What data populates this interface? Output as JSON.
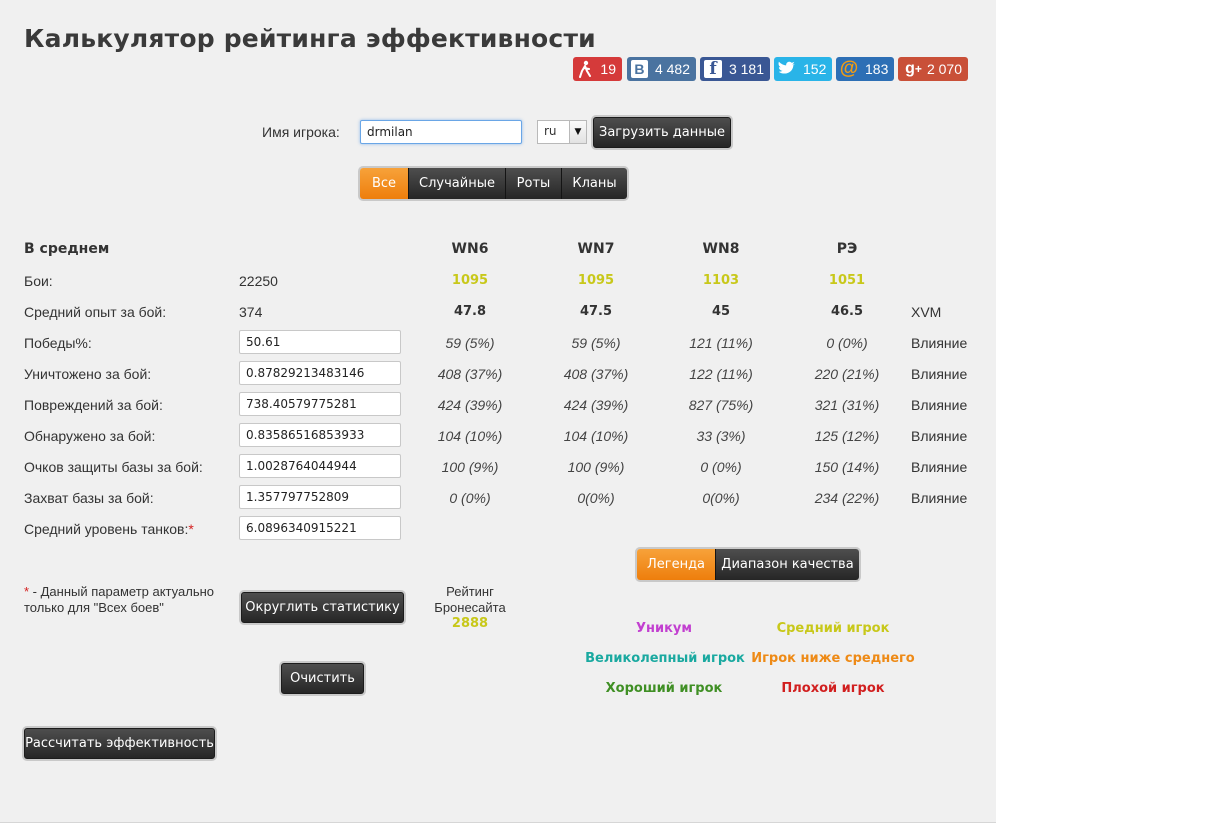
{
  "title": "Калькулятор рейтинга эффективности",
  "social": [
    {
      "name": "surfingbird",
      "count": "19",
      "color": "#d53a3a",
      "icon": "walker-icon"
    },
    {
      "name": "vk",
      "count": "4 482",
      "color": "#4a73a0",
      "icon": "vk-icon"
    },
    {
      "name": "facebook",
      "count": "3 181",
      "color": "#3a5794",
      "icon": "facebook-icon"
    },
    {
      "name": "twitter",
      "count": "152",
      "color": "#29b4e8",
      "icon": "twitter-icon"
    },
    {
      "name": "mailru",
      "count": "183",
      "color": "#2d6fb5",
      "icon": "at-icon"
    },
    {
      "name": "googleplus",
      "count": "2 070",
      "color": "#c95038",
      "icon": "gplus-icon"
    }
  ],
  "player": {
    "label": "Имя игрока:",
    "value": "drmilan",
    "server": "ru",
    "load_button": "Загрузить данные"
  },
  "filter_tabs": [
    "Все",
    "Случайные",
    "Роты",
    "Кланы"
  ],
  "table": {
    "section_label": "В среднем",
    "columns": [
      "WN6",
      "WN7",
      "WN8",
      "РЭ"
    ],
    "battles": {
      "label": "Бои:",
      "value": "22250",
      "ratings": [
        "1095",
        "1095",
        "1103",
        "1051"
      ]
    },
    "avg_xp": {
      "label": "Средний опыт за бой:",
      "value": "374",
      "ratings": [
        "47.8",
        "47.5",
        "45",
        "46.5"
      ],
      "extra": "XVM"
    },
    "rows": [
      {
        "label": "Победы%:",
        "value": "50.61",
        "cols": [
          "59 (5%)",
          "59 (5%)",
          "121 (11%)",
          "0 (0%)"
        ],
        "extra": "Влияние"
      },
      {
        "label": "Уничтожено за бой:",
        "value": "0.87829213483146",
        "cols": [
          "408 (37%)",
          "408 (37%)",
          "122 (11%)",
          "220 (21%)"
        ],
        "extra": "Влияние"
      },
      {
        "label": "Повреждений за бой:",
        "value": "738.40579775281",
        "cols": [
          "424 (39%)",
          "424 (39%)",
          "827 (75%)",
          "321 (31%)"
        ],
        "extra": "Влияние"
      },
      {
        "label": "Обнаружено за бой:",
        "value": "0.83586516853933",
        "cols": [
          "104 (10%)",
          "104 (10%)",
          "33 (3%)",
          "125 (12%)"
        ],
        "extra": "Влияние"
      },
      {
        "label": "Очков защиты базы за бой:",
        "value": "1.0028764044944",
        "cols": [
          "100 (9%)",
          "100 (9%)",
          "0 (0%)",
          "150 (14%)"
        ],
        "extra": "Влияние"
      },
      {
        "label": "Захват базы за бой:",
        "value": "1.357797752809",
        "cols": [
          "0 (0%)",
          "0(0%)",
          "0(0%)",
          "234 (22%)"
        ],
        "extra": "Влияние"
      }
    ],
    "tank_level": {
      "label": "Средний уровень танков:",
      "star": "*",
      "value": "6.0896340915221"
    }
  },
  "note": {
    "star": "*",
    "text": " - Данный параметр актуально только для \"Всех боев\""
  },
  "round_button": "Округлить статистику",
  "armor_rating": {
    "label_line1": "Рейтинг",
    "label_line2": "Бронесайта",
    "value": "2888"
  },
  "clear_button": "Очистить",
  "calc_button": "Рассчитать эффективность",
  "legend_tabs": [
    "Легенда",
    "Диапазон качества"
  ],
  "legend": [
    {
      "text": "Уникум",
      "color": "#c23fd0"
    },
    {
      "text": "Средний игрок",
      "color": "#c8c81a"
    },
    {
      "text": "Великолепный игрок",
      "color": "#1aa9a0"
    },
    {
      "text": "Игрок ниже среднего",
      "color": "#ee8a16"
    },
    {
      "text": "Хороший игрок",
      "color": "#3f8f24"
    },
    {
      "text": "Плохой игрок",
      "color": "#d11f1f"
    }
  ],
  "colors": {
    "accent": "#ee7e0c",
    "rating_yellow": "#c8c81a"
  }
}
